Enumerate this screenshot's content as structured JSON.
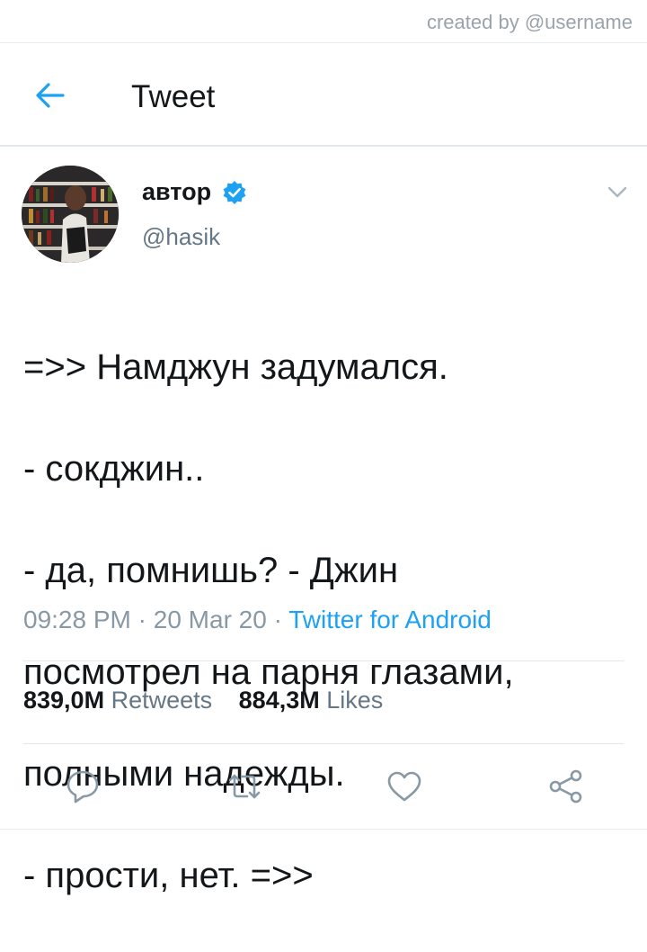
{
  "credit": "created by @username",
  "header": {
    "title": "Tweet",
    "back_icon": "arrow-left-icon"
  },
  "tweet": {
    "author_name": "автор",
    "handle": "@hasik",
    "text_lines": [
      "=>> Намджун задумался.",
      "- сокджин..",
      "- да, помнишь? - Джин",
      "посмотрел на парня глазами,",
      "полными надежды.",
      "- прости, нет. =>>"
    ],
    "time": "09:28 PM",
    "date": "20 Mar 20",
    "source": "Twitter for Android",
    "retweets_count": "839,0M",
    "retweets_label": "Retweets",
    "likes_count": "884,3M",
    "likes_label": "Likes"
  },
  "actions": [
    "reply-icon",
    "retweet-icon",
    "like-icon",
    "share-icon"
  ],
  "colors": {
    "accent": "#1da1f2",
    "text": "#14171a",
    "muted": "#657786",
    "divider": "#e1e8ed"
  }
}
